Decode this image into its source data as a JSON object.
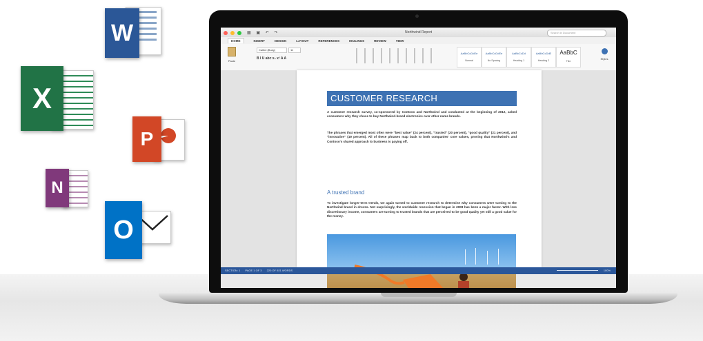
{
  "apps": [
    {
      "name": "word",
      "letter": "W",
      "color": "#2b5797"
    },
    {
      "name": "excel",
      "letter": "X",
      "color": "#217346"
    },
    {
      "name": "powerpoint",
      "letter": "P",
      "color": "#d24726"
    },
    {
      "name": "onenote",
      "letter": "N",
      "color": "#80397b"
    },
    {
      "name": "outlook",
      "letter": "O",
      "color": "#0072c6"
    }
  ],
  "window": {
    "title": "Northwind Report",
    "search_placeholder": "Search in Document"
  },
  "ribbon": {
    "tabs": [
      "HOME",
      "INSERT",
      "DESIGN",
      "LAYOUT",
      "REFERENCES",
      "MAILINGS",
      "REVIEW",
      "VIEW"
    ],
    "paste_label": "Paste",
    "font_name": "Calibri (Body)",
    "font_size": "11",
    "format_buttons": "B  I  U  abc  x₂  x²   A  A",
    "styles": [
      {
        "preview": "AaBbCcDdEe",
        "name": "Normal"
      },
      {
        "preview": "AaBbCcDdEe",
        "name": "No Spacing"
      },
      {
        "preview": "AaBbCcDd",
        "name": "Heading 1"
      },
      {
        "preview": "AaBbCcDdE",
        "name": "Heading 2"
      },
      {
        "preview": "AaBbC",
        "name": "Title"
      }
    ],
    "styles_pane_label": "Styles"
  },
  "document": {
    "heading": "CUSTOMER RESEARCH",
    "para1": "A customer research survey, co-sponsored by Contoso and Northwind and conducted at the beginning of 2012, asked consumers why they chose to buy Northwind-brand electronics over other name brands.",
    "para2": "The phrases that emerged most often were \"best value\" (24 percent), \"trusted\" (20 percent), \"good quality\" (21 percent), and \"innovative\" (19 percent). All of these phrases map back to both companies' core values, proving that Northwind's and Contoso's shared approach to business is paying off.",
    "subheading": "A trusted brand",
    "para3": "To investigate longer-term trends, we again turned to customer research to determine why consumers were turning to the Northwind brand in droves. Not surprisingly, the worldwide recession that began in 2008 has been a major factor. With less discretionary income, consumers are turning to trusted brands that are perceived to be good quality yet still a good value for the money."
  },
  "statusbar": {
    "section": "SECTION: 1",
    "page": "PAGE 1 OF 3",
    "words": "220 OF 921 WORDS",
    "zoom": "100%"
  }
}
